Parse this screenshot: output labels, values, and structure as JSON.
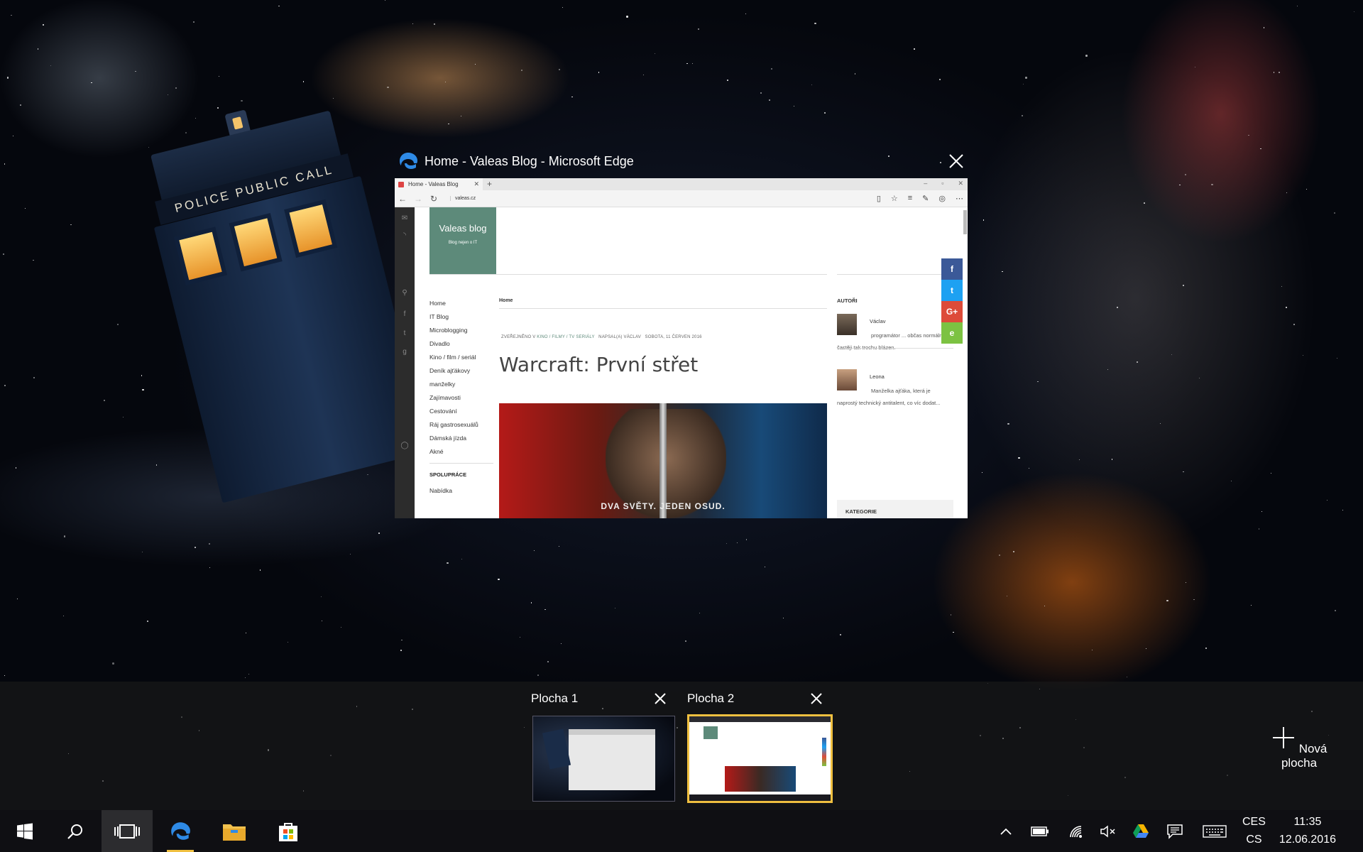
{
  "window": {
    "title": "Home - Valeas Blog - Microsoft Edge",
    "tab_title": "Home - Valeas Blog",
    "new_tab": "+",
    "controls": [
      "–",
      "▫",
      "✕"
    ],
    "address": "valeas.cz"
  },
  "site": {
    "logo_title": "Valeas blog",
    "logo_subtitle": "Blog nejen o IT",
    "menu": [
      "Home",
      "IT Blog",
      "Microblogging",
      "Divadlo",
      "Kino / film / seriál",
      "Deník ajťákovy",
      "manželky",
      "Zajímavosti",
      "Cestování",
      "Ráj gastrosexuálů",
      "Dámská jízda",
      "Akné"
    ],
    "menu_section": "SPOLUPRÁCE",
    "menu_section_items": [
      "Nabídka"
    ],
    "breadcrumb": "Home",
    "meta_prefix": "ZVEŘEJNĚNO V",
    "meta_category": "KINO / FILMY / TV SERIÁLY",
    "meta_author": "NAPSAL(A) VÁCLAV",
    "meta_date": "SOBOTA, 11 ČERVEN 2016",
    "post_title": "Warcraft: První střet",
    "hero_caption": "DVA SVĚTY. JEDEN OSUD.",
    "sidebar_title": "AUTOŘI",
    "authors": [
      {
        "name": "Václav",
        "bio": "programátor ... občas normální, častěji tak trochu blázen."
      },
      {
        "name": "Leona",
        "bio": "Manželka ajťáka, která je naprostý technický antitalent, co víc dodat..."
      }
    ],
    "categories_title": "KATEGORIE",
    "share_colors": [
      "#3b5998",
      "#1da1f2",
      "#dd4b39",
      "#7cc242"
    ]
  },
  "task_view": {
    "desktops": [
      {
        "label": "Plocha 1",
        "active": false
      },
      {
        "label": "Plocha 2",
        "active": true
      }
    ],
    "new_desktop": "Nová plocha"
  },
  "taskbar": {
    "icons": [
      "windows-start-icon",
      "search-icon",
      "task-view-icon",
      "edge-icon",
      "file-explorer-icon",
      "store-icon"
    ],
    "tray_icons": [
      "chevron-up-icon",
      "battery-icon",
      "wifi-icon",
      "volume-muted-icon",
      "google-drive-icon",
      "action-center-icon",
      "keyboard-icon"
    ],
    "lang_top": "CES",
    "lang_bottom": "CS",
    "time": "11:35",
    "date": "12.06.2016",
    "accent": "#f0c040"
  }
}
